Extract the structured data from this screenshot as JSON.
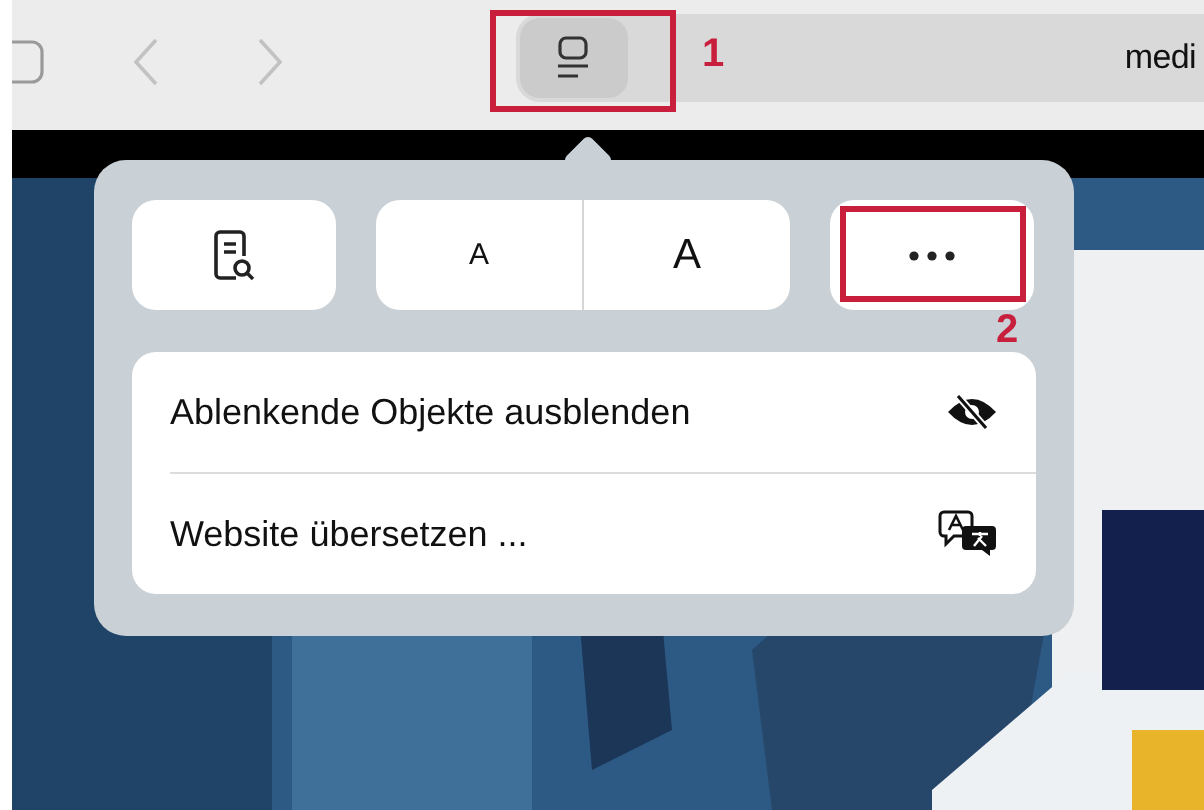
{
  "toolbar": {
    "address_text": "medi"
  },
  "reader_popover": {
    "font_buttons": [
      {
        "label": "A",
        "kind": "small"
      },
      {
        "label": "A",
        "kind": "large"
      }
    ],
    "menu_items": [
      {
        "label": "Ablenkende Objekte ausblenden",
        "kind": "hide"
      },
      {
        "label": "Website übersetzen ...",
        "kind": "translate"
      }
    ]
  },
  "annotations": [
    {
      "label": "1",
      "kind": "reader"
    },
    {
      "label": "2",
      "kind": "more"
    }
  ]
}
